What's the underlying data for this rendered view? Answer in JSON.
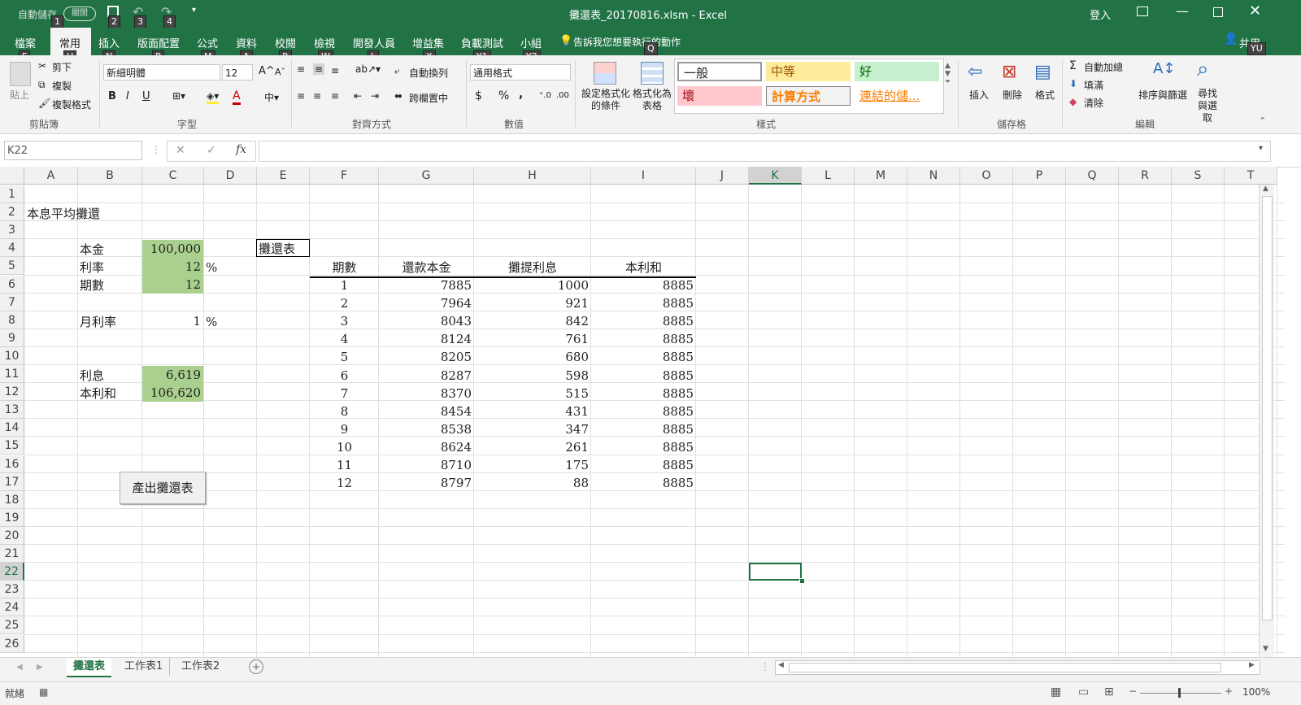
{
  "titlebar": {
    "autosave_label": "自動儲存",
    "autosave_state": "關閉",
    "title": "攤還表_20170816.xlsm  -  Excel",
    "signin": "登入",
    "keytips": [
      "1",
      "2",
      "3",
      "4"
    ]
  },
  "ribbon_tabs": {
    "items": [
      "檔案",
      "常用",
      "插入",
      "版面配置",
      "公式",
      "資料",
      "校閱",
      "檢視",
      "開發人員",
      "增益集",
      "負載測試",
      "小組"
    ],
    "tell_me": "告訴我您想要執行的動作",
    "share": "共用",
    "keytips": [
      "F",
      "H",
      "N",
      "P",
      "M",
      "A",
      "R",
      "W",
      "L",
      "X",
      "Y1",
      "Y2",
      "Q",
      "YU"
    ]
  },
  "ribbon": {
    "clipboard": {
      "paste": "貼上",
      "cut": "剪下",
      "copy": "複製",
      "format_painter": "複製格式",
      "group": "剪貼簿"
    },
    "font": {
      "name": "新細明體",
      "size": "12",
      "bold": "B",
      "italic": "I",
      "underline": "U",
      "group": "字型"
    },
    "alignment": {
      "wrap": "自動換列",
      "merge": "跨欄置中",
      "group": "對齊方式"
    },
    "number": {
      "format": "通用格式",
      "currency": "$",
      "percent": "%",
      "comma": ",",
      "group": "數值"
    },
    "styles": {
      "conditional": "設定格式化的條件",
      "table": "格式化為表格",
      "normal": "一般",
      "neutral": "中等",
      "good": "好",
      "bad": "壞",
      "calc": "計算方式",
      "link": "連結的儲...",
      "group": "樣式"
    },
    "cells": {
      "insert": "插入",
      "delete": "刪除",
      "format": "格式",
      "group": "儲存格"
    },
    "editing": {
      "autosum": "自動加總",
      "fill": "填滿",
      "clear": "清除",
      "sort": "排序與篩選",
      "find": "尋找與選取",
      "group": "編輯"
    }
  },
  "formula_bar": {
    "name_box": "K22",
    "fx": "fx",
    "value": ""
  },
  "columns": [
    "A",
    "B",
    "C",
    "D",
    "E",
    "F",
    "G",
    "H",
    "I",
    "J",
    "K",
    "L",
    "M",
    "N",
    "O",
    "P",
    "Q",
    "R",
    "S",
    "T"
  ],
  "rows": [
    "1",
    "2",
    "3",
    "4",
    "5",
    "6",
    "7",
    "8",
    "9",
    "10",
    "11",
    "12",
    "13",
    "14",
    "15",
    "16",
    "17",
    "18",
    "19",
    "20",
    "21",
    "22",
    "23",
    "24",
    "25",
    "26"
  ],
  "sheet": {
    "title": "本息平均攤還",
    "principal_label": "本金",
    "principal": "100,000",
    "rate_label": "利率",
    "rate": "12",
    "rate_unit": "%",
    "periods_label": "期數",
    "periods": "12",
    "monthly_rate_label": "月利率",
    "monthly_rate": "1",
    "monthly_rate_unit": "%",
    "interest_label": "利息",
    "interest": "6,619",
    "total_label": "本利和",
    "total": "106,620",
    "button": "產出攤還表",
    "table_title": "攤還表",
    "table_headers": [
      "期數",
      "還款本金",
      "攤提利息",
      "本利和"
    ],
    "table_rows": [
      [
        "1",
        "7885",
        "1000",
        "8885"
      ],
      [
        "2",
        "7964",
        "921",
        "8885"
      ],
      [
        "3",
        "8043",
        "842",
        "8885"
      ],
      [
        "4",
        "8124",
        "761",
        "8885"
      ],
      [
        "5",
        "8205",
        "680",
        "8885"
      ],
      [
        "6",
        "8287",
        "598",
        "8885"
      ],
      [
        "7",
        "8370",
        "515",
        "8885"
      ],
      [
        "8",
        "8454",
        "431",
        "8885"
      ],
      [
        "9",
        "8538",
        "347",
        "8885"
      ],
      [
        "10",
        "8624",
        "261",
        "8885"
      ],
      [
        "11",
        "8710",
        "175",
        "8885"
      ],
      [
        "12",
        "8797",
        "88",
        "8885"
      ]
    ]
  },
  "sheet_tabs": [
    "攤還表",
    "工作表1",
    "工作表2"
  ],
  "status": {
    "ready": "就緒",
    "zoom": "100%"
  },
  "colors": {
    "excel_green": "#217346",
    "input_fill": "#a9d08e",
    "selection": "#217346"
  }
}
